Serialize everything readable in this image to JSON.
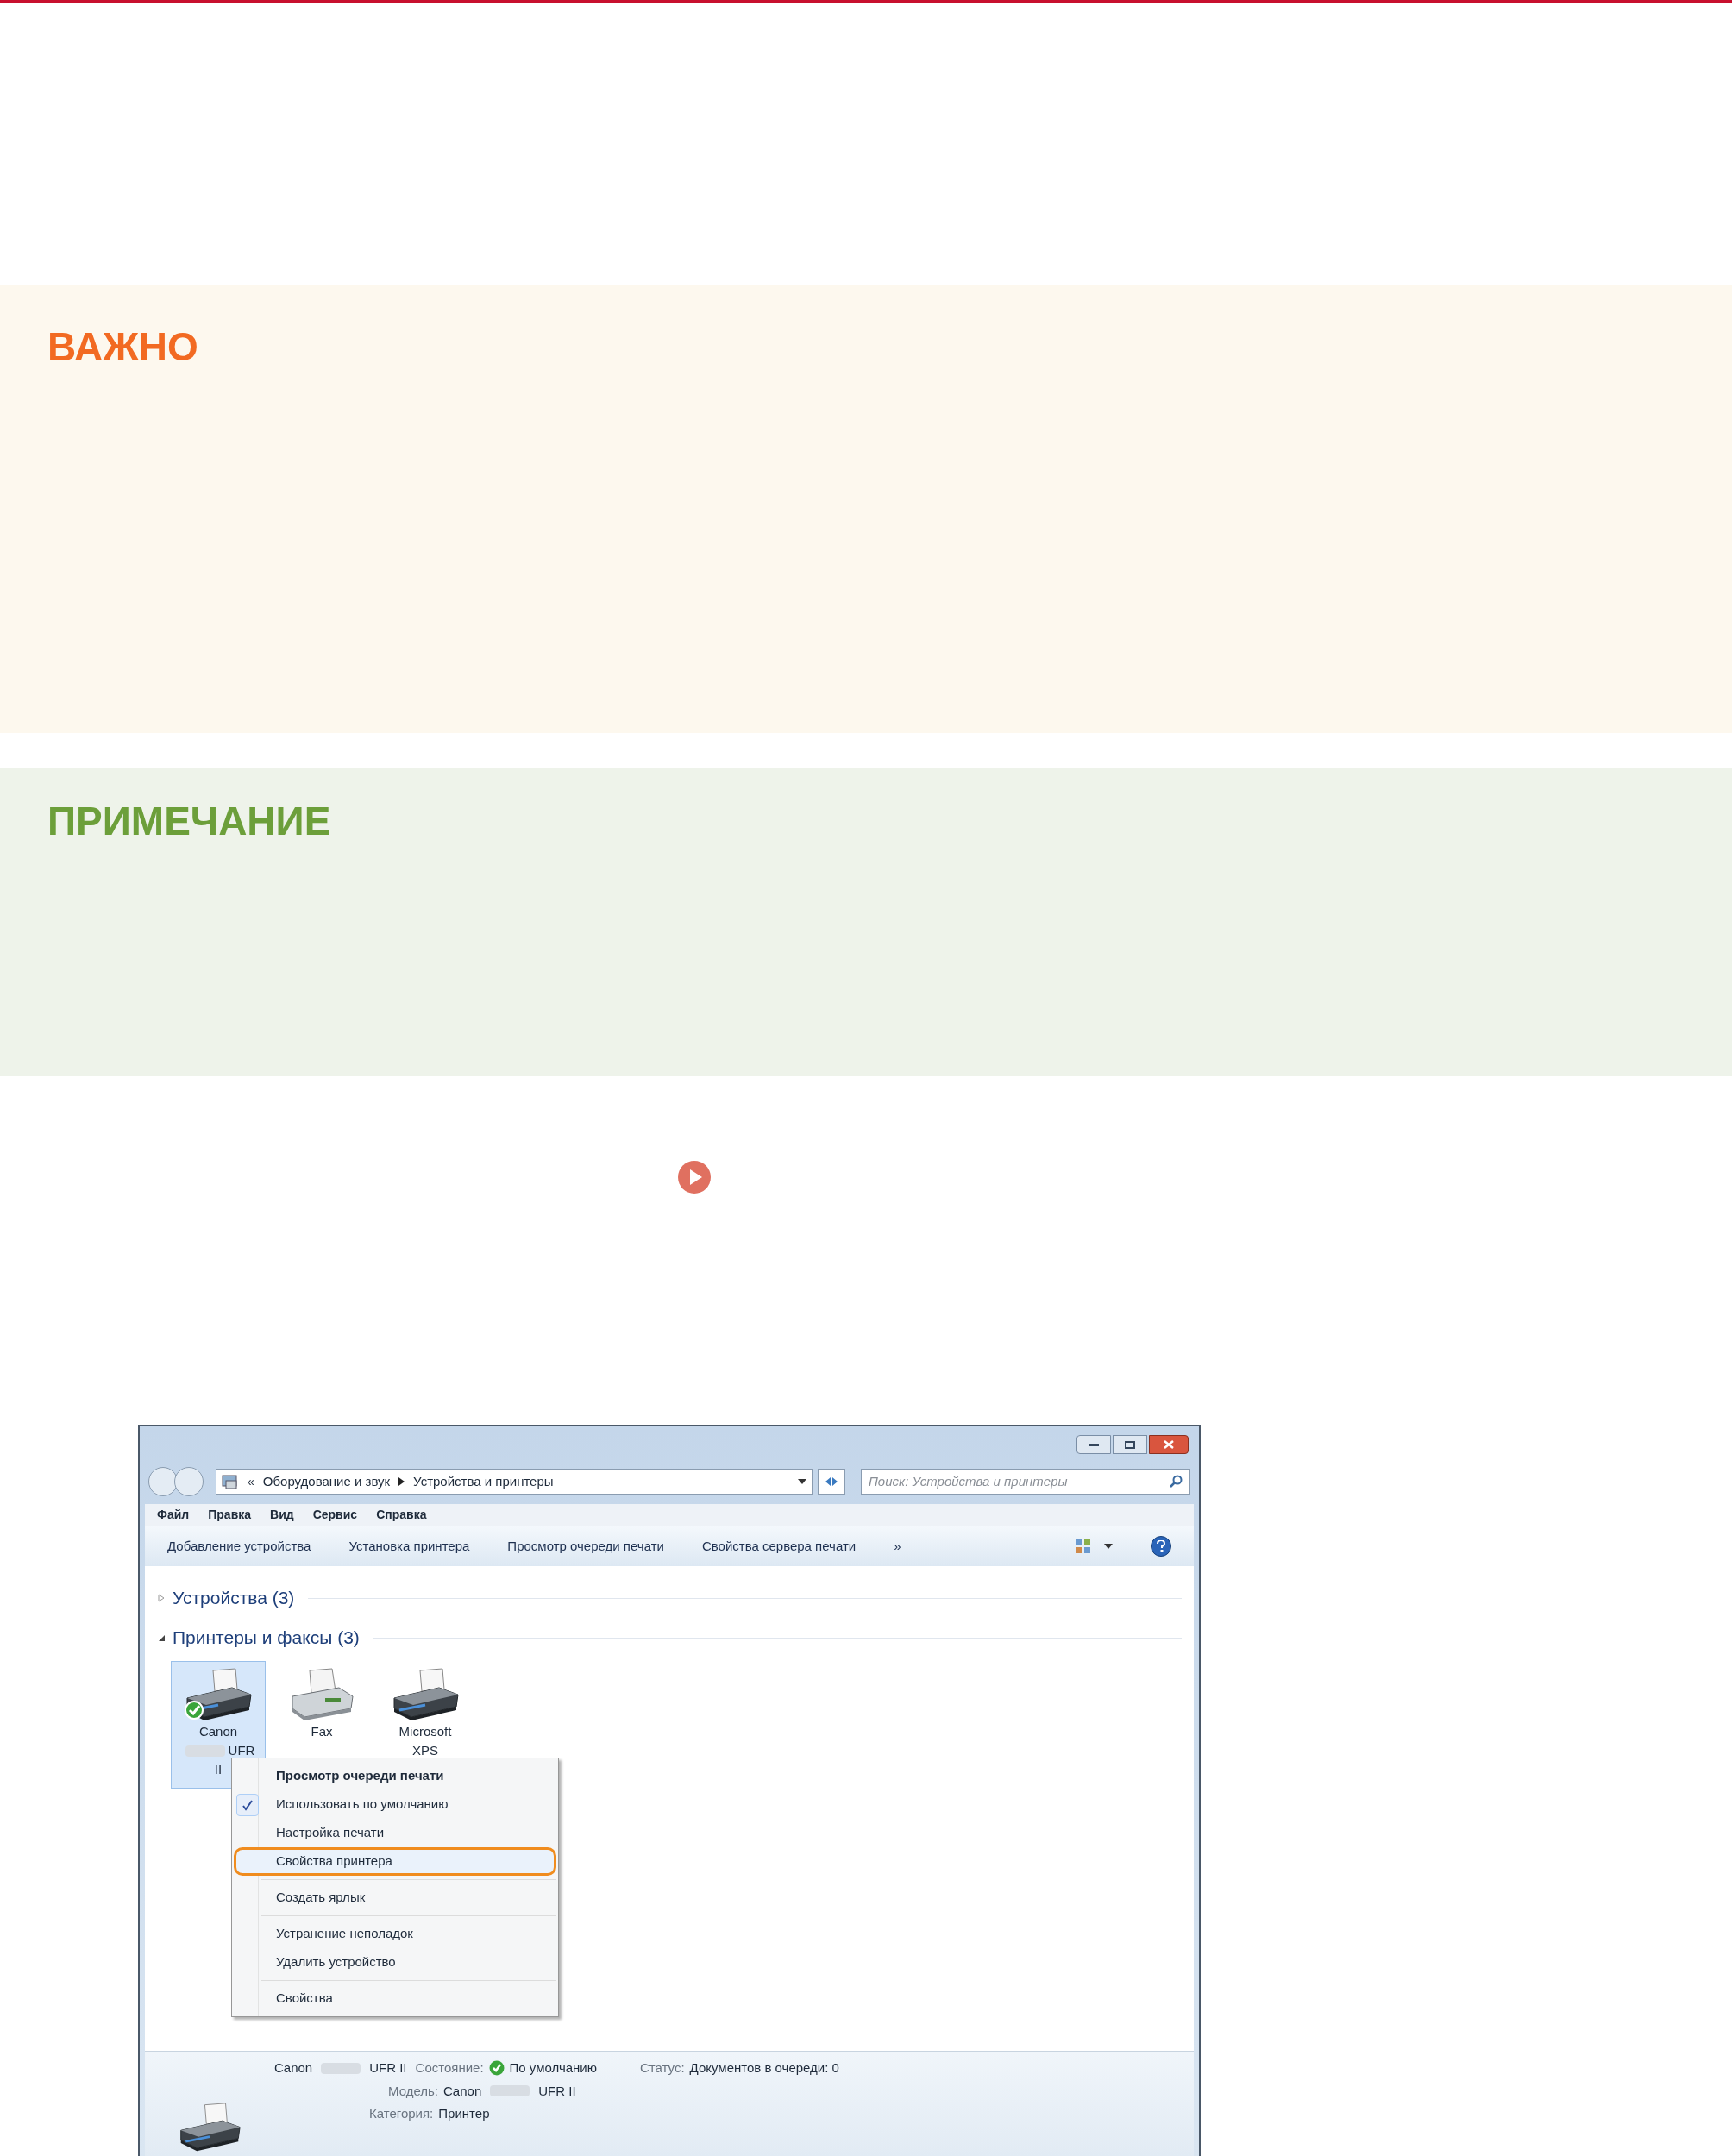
{
  "important": {
    "title": "ВАЖНО"
  },
  "note": {
    "title": "ПРИМЕЧАНИЕ"
  },
  "link_marker": {
    "kind": "play"
  },
  "window": {
    "address": {
      "overflow": "«",
      "path": [
        "Оборудование и звук",
        "Устройства и принтеры"
      ],
      "search_placeholder": "Поиск: Устройства и принтеры"
    },
    "menu": [
      "Файл",
      "Правка",
      "Вид",
      "Сервис",
      "Справка"
    ],
    "toolbar": [
      "Добавление устройства",
      "Установка принтера",
      "Просмотр очереди печати",
      "Свойства сервера печати",
      "»"
    ],
    "groups": [
      {
        "label": "Устройства (3)",
        "expanded": false
      },
      {
        "label": "Принтеры и факсы (3)",
        "expanded": true
      }
    ],
    "devices": [
      {
        "kind": "printer",
        "lines": [
          {
            "kind": "text",
            "text": "Canon"
          },
          {
            "kind": "blurred_prefix",
            "text": "UFR"
          },
          {
            "kind": "text",
            "text": "II"
          }
        ],
        "selected": true,
        "default": true
      },
      {
        "kind": "fax",
        "lines": [
          {
            "kind": "text",
            "text": "Fax"
          }
        ],
        "selected": false,
        "default": false
      },
      {
        "kind": "printer",
        "lines": [
          {
            "kind": "text",
            "text": "Microsoft"
          },
          {
            "kind": "text",
            "text": "XPS"
          }
        ],
        "selected": false,
        "default": false
      }
    ],
    "context_menu": [
      {
        "kind": "item",
        "label": "Просмотр очереди печати",
        "bold": true,
        "checked": false,
        "highlighted": false
      },
      {
        "kind": "item",
        "label": "Использовать по умолчанию",
        "bold": false,
        "checked": true,
        "highlighted": false
      },
      {
        "kind": "item",
        "label": "Настройка печати",
        "bold": false,
        "checked": false,
        "highlighted": false
      },
      {
        "kind": "item",
        "label": "Свойства принтера",
        "bold": false,
        "checked": false,
        "highlighted": true
      },
      {
        "kind": "separator"
      },
      {
        "kind": "item",
        "label": "Создать ярлык",
        "bold": false,
        "checked": false,
        "highlighted": false
      },
      {
        "kind": "separator"
      },
      {
        "kind": "item",
        "label": "Устранение неполадок",
        "bold": false,
        "checked": false,
        "highlighted": false
      },
      {
        "kind": "item",
        "label": "Удалить устройство",
        "bold": false,
        "checked": false,
        "highlighted": false
      },
      {
        "kind": "separator"
      },
      {
        "kind": "item",
        "label": "Свойства",
        "bold": false,
        "checked": false,
        "highlighted": false
      }
    ],
    "details": {
      "name_start": "Canon",
      "name_end": "UFR II",
      "state_label": "Состояние:",
      "state_value": "По умолчанию",
      "status_label": "Статус:",
      "status_value": "Документов в очереди: 0",
      "model_label": "Модель:",
      "model_start": "Canon",
      "model_end": "UFR II",
      "category_label": "Категория:",
      "category_value": "Принтер"
    }
  }
}
